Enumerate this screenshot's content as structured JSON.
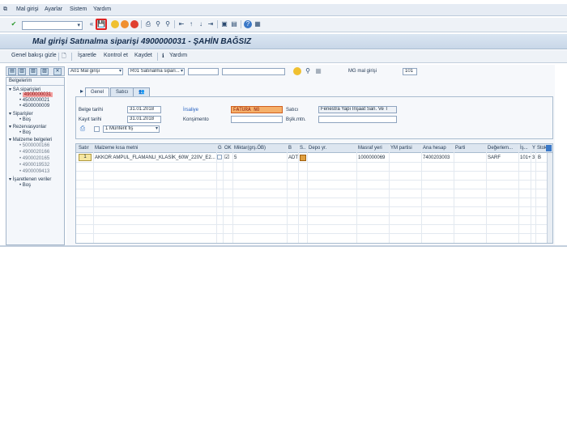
{
  "menu": [
    "Mal girişi",
    "Ayarlar",
    "Sistem",
    "Yardım"
  ],
  "title": "Mal girişi Satınalma siparişi 4900000031 - ŞAHİN BAĞSIZ",
  "toolbar2": {
    "hide_details": "Genel bakışı gizle",
    "mark": "İşaretle",
    "check": "Kontrol et",
    "post": "Kaydet",
    "help": "Yardım"
  },
  "sidebar": {
    "header": "Belgelerim",
    "groups": [
      {
        "label": "SA siparişleri",
        "items": [
          "4900000031",
          "4500000021",
          "4500000009"
        ]
      },
      {
        "label": "Siparişler",
        "items": [
          "Boş"
        ]
      },
      {
        "label": "Rezervasyonlar",
        "items": [
          "Boş"
        ]
      },
      {
        "label": "Malzeme belgeleri",
        "items": [
          "5000000166",
          "4900020166",
          "4900020165",
          "4900019532",
          "4900009413"
        ]
      },
      {
        "label": "İşaretlenen veriler",
        "items": [
          "Boş"
        ]
      }
    ]
  },
  "header_fields": {
    "action": "A01 Mal girişi",
    "reference": "R01 Satınalma sipari...",
    "mvt_type_label": "MG mal girişi",
    "mvt_type": "101"
  },
  "tabs": [
    "Genel",
    "Satıcı"
  ],
  "general": {
    "doc_date_label": "Belge tarihi",
    "doc_date": "31.01.2018",
    "post_date_label": "Kayıt tarihi",
    "post_date": "31.01.2018",
    "delivery_note_label": "İrsaliye",
    "delivery_note": "FATURA NO",
    "bill_of_lading_label": "Konşimento",
    "vendor_label": "Satıcı",
    "vendor": "Fenestra Yapı İnşaat San. Ve T",
    "header_text_label": "Bşlk.mtn.",
    "slip_option": "1 Münferit fiş"
  },
  "grid": {
    "columns": [
      "Satır",
      "Malzeme kısa metni",
      "G",
      "OK",
      "Miktar(grş.ÖB)",
      "B",
      "S..",
      "Depo yr.",
      "Masraf yeri",
      "YM partisi",
      "Ana hesap",
      "Parti",
      "Değerlem...",
      "İş...",
      "Y",
      "Stok"
    ],
    "rows": [
      {
        "line": "1",
        "text": "AKKOR AMPUL_FLAMANLI_KLASİK_60W_220V_E2...",
        "qty": "5",
        "unit": "ADT",
        "cost_center": "1000000069",
        "gl_account": "7400203003",
        "valuation": "SARF",
        "mvt": "101",
        "plus": "+",
        "y": "3",
        "stock": "B"
      }
    ]
  }
}
